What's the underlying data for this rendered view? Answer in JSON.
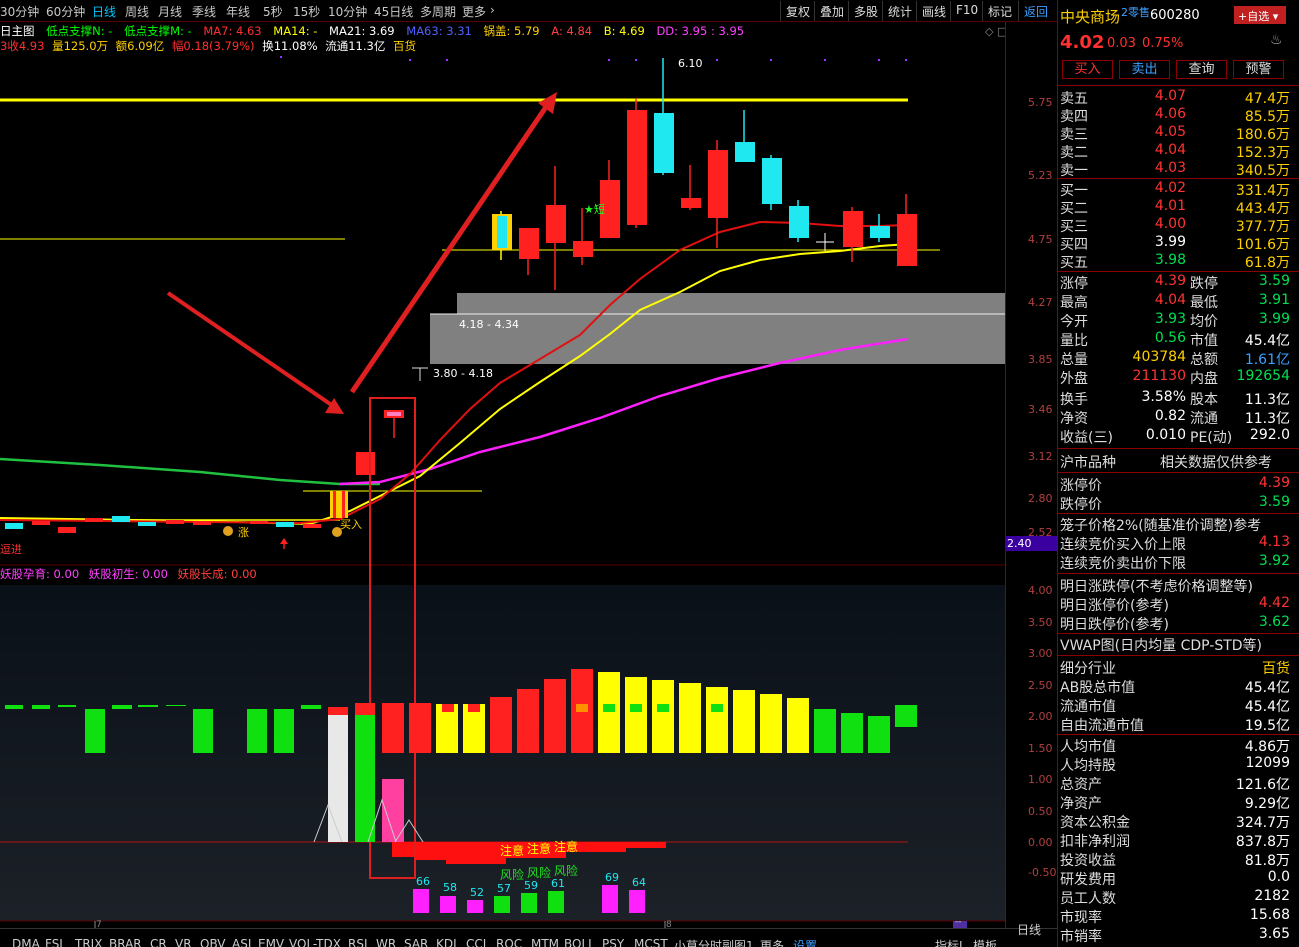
{
  "toolbar": {
    "periods": [
      "30分钟",
      "60分钟",
      "日线",
      "周线",
      "月线",
      "季线",
      "年线",
      "5秒",
      "15秒",
      "10分钟",
      "45日线",
      "多周期",
      "更多"
    ],
    "active_period": "日线",
    "right_buttons": [
      "复权",
      "叠加",
      "多股",
      "统计",
      "画线",
      "F10",
      "标记",
      "返回"
    ]
  },
  "legend": {
    "line1": [
      "日主图",
      "低点支撑N: -",
      "低点支撑M: -",
      "MA7: 4.63",
      "MA14: -",
      "MA21: 3.69",
      "MA63: 3.31",
      "锅盖: 5.79",
      "A: 4.84",
      "B: 4.69",
      "DD: 3.95 : 3.95"
    ],
    "line2": [
      "3收4.93",
      "量125.0万",
      "额6.09亿",
      "幅0.18(3.79%)",
      "换11.08%",
      "流通11.3亿",
      "百货"
    ],
    "indicator": [
      "妖股孕育: 0.00",
      "妖股初生: 0.00",
      "妖股长成: 0.00"
    ]
  },
  "price_axis": [
    "5.75",
    "5.23",
    "4.75",
    "4.27",
    "3.85",
    "3.46",
    "3.12",
    "2.80",
    "2.52"
  ],
  "price_axis_tag": "2.40",
  "indicator_axis": [
    "4.00",
    "3.50",
    "3.00",
    "2.50",
    "2.00",
    "1.50",
    "1.00",
    "0.50",
    "0.00",
    "-0.50"
  ],
  "chart_labels": {
    "high": "6.10",
    "zone1": "4.18 - 4.34",
    "zone2": "3.80 - 4.18",
    "buy": "买入",
    "rise": "涨",
    "advance": "逗进",
    "star": "★短",
    "warn": [
      "注意",
      "注意",
      "注意"
    ],
    "risk": [
      "风险",
      "风险",
      "风险"
    ],
    "counts": [
      "66",
      "58",
      "52",
      "57",
      "59",
      "61",
      "69",
      "64"
    ],
    "month_marks": [
      "7",
      "8"
    ],
    "mini_marker": "--"
  },
  "bottom_tabs": [
    "DMA",
    "FSL",
    "TRIX",
    "BRAR",
    "CR",
    "VR",
    "OBV",
    "ASI",
    "EMV",
    "VOL-TDX",
    "RSI",
    "WR",
    "SAR",
    "KDJ",
    "CCI",
    "ROC",
    "MTM",
    "BOLL",
    "PSY",
    "MCST",
    "小草分时副图1",
    "更多",
    "设置"
  ],
  "bottom_right": [
    "指标Ⅰ",
    "模板",
    "日线"
  ],
  "quote": {
    "name": "中央商场",
    "tag": "2零售",
    "code": "600280",
    "add_btn": "+自选",
    "price": "4.02",
    "change": "0.03",
    "pct": "0.75%",
    "buttons": [
      "买入",
      "卖出",
      "查询",
      "预警"
    ],
    "asks": [
      {
        "label": "卖五",
        "price": "4.07",
        "vol": "47.4万"
      },
      {
        "label": "卖四",
        "price": "4.06",
        "vol": "85.5万"
      },
      {
        "label": "卖三",
        "price": "4.05",
        "vol": "180.6万"
      },
      {
        "label": "卖二",
        "price": "4.04",
        "vol": "152.3万"
      },
      {
        "label": "卖一",
        "price": "4.03",
        "vol": "340.5万"
      }
    ],
    "bids": [
      {
        "label": "买一",
        "price": "4.02",
        "vol": "331.4万"
      },
      {
        "label": "买二",
        "price": "4.01",
        "vol": "443.4万"
      },
      {
        "label": "买三",
        "price": "4.00",
        "vol": "377.7万"
      },
      {
        "label": "买四",
        "price": "3.99",
        "vol": "101.6万"
      },
      {
        "label": "买五",
        "price": "3.98",
        "vol": "61.8万"
      }
    ],
    "stats": [
      {
        "l1": "涨停",
        "v1": "4.39",
        "l2": "跌停",
        "v2": "3.59"
      },
      {
        "l1": "最高",
        "v1": "4.04",
        "l2": "最低",
        "v2": "3.91"
      },
      {
        "l1": "今开",
        "v1": "3.93",
        "l2": "均价",
        "v2": "3.99"
      },
      {
        "l1": "量比",
        "v1": "0.56",
        "l2": "市值",
        "v2": "45.4亿"
      },
      {
        "l1": "总量",
        "v1": "403784",
        "l2": "总额",
        "v2": "1.61亿"
      },
      {
        "l1": "外盘",
        "v1": "211130",
        "l2": "内盘",
        "v2": "192654"
      },
      {
        "l1": "换手",
        "v1": "3.58%",
        "l2": "股本",
        "v2": "11.3亿"
      },
      {
        "l1": "净资",
        "v1": "0.82",
        "l2": "流通",
        "v2": "11.3亿"
      },
      {
        "l1": "收益(三)",
        "v1": "0.010",
        "l2": "PE(动)",
        "v2": "292.0"
      }
    ],
    "section_title": "沪市品种",
    "section_note": "相关数据仅供参考",
    "limits": [
      {
        "label": "涨停价",
        "value": "4.39"
      },
      {
        "label": "跌停价",
        "value": "3.59"
      }
    ],
    "cage_title": "笼子价格2%(随基准价调整)参考",
    "cage": [
      {
        "label": "连续竞价买入价上限",
        "value": "4.13"
      },
      {
        "label": "连续竞价卖出价下限",
        "value": "3.92"
      }
    ],
    "tomorrow_title": "明日涨跌停(不考虑价格调整等)",
    "tomorrow": [
      {
        "label": "明日涨停价(参考)",
        "value": "4.42"
      },
      {
        "label": "明日跌停价(参考)",
        "value": "3.62"
      }
    ],
    "vwap_title": "VWAP图(日内均量 CDP-STD等)",
    "fund": [
      {
        "label": "细分行业",
        "value": "百货"
      },
      {
        "label": "AB股总市值",
        "value": "45.4亿"
      },
      {
        "label": "流通市值",
        "value": "45.4亿"
      },
      {
        "label": "自由流通市值",
        "value": "19.5亿"
      },
      {
        "label": "人均市值",
        "value": "4.86万"
      },
      {
        "label": "人均持股",
        "value": "12099"
      },
      {
        "label": "总资产",
        "value": "121.6亿"
      },
      {
        "label": "净资产",
        "value": "9.29亿"
      },
      {
        "label": "资本公积金",
        "value": "324.7万"
      },
      {
        "label": "扣非净利润",
        "value": "837.8万"
      },
      {
        "label": "投资收益",
        "value": "81.8万"
      },
      {
        "label": "研发费用",
        "value": "0.0"
      },
      {
        "label": "员工人数",
        "value": "2182"
      },
      {
        "label": "市现率",
        "value": "15.68"
      },
      {
        "label": "市销率",
        "value": "3.65"
      }
    ]
  },
  "colors": {
    "up": "#ff2020",
    "down": "#20e8f0",
    "ma_red": "#e01010",
    "ma_yellow": "#ffff00",
    "ma_magenta": "#ff20ff",
    "ma_green": "#20c040"
  }
}
